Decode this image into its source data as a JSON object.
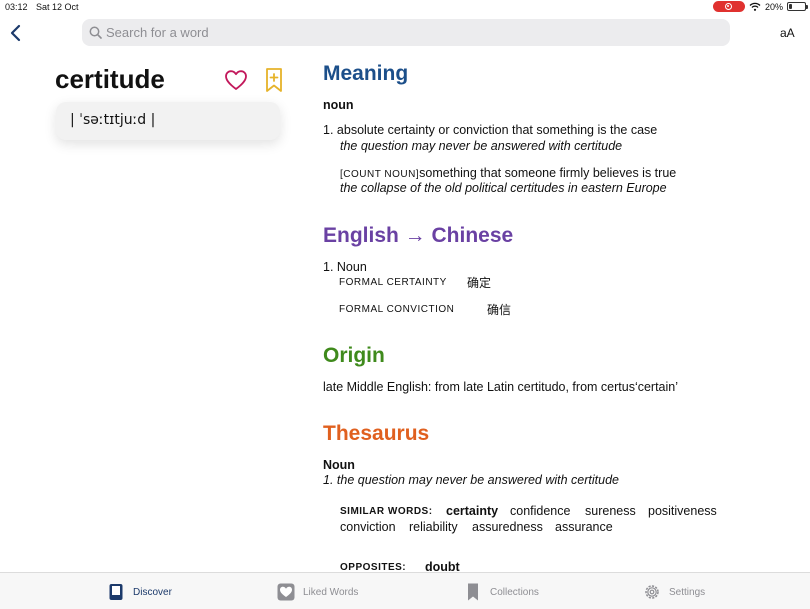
{
  "status_bar": {
    "time": "03:12",
    "date": "Sat 12 Oct",
    "battery": "20%",
    "battery_level": 0.2
  },
  "search": {
    "placeholder": "Search for a word",
    "value": ""
  },
  "text_size_button": "aA",
  "entry": {
    "word": "certitude",
    "pronunciation": "| ˈsəːtɪtjuːd |"
  },
  "meaning": {
    "heading": "Meaning",
    "pos": "noun",
    "senses": [
      {
        "number": "1.",
        "definition": "absolute certainty or conviction that something is the case",
        "example": "the question may never be answered with certitude"
      },
      {
        "label": "[COUNT NOUN]",
        "definition": "something that someone firmly believes is true",
        "example": "the collapse of the old political certitudes in eastern Europe"
      }
    ]
  },
  "translation": {
    "heading": "English → Chinese",
    "pos_line": "1. Noun",
    "items": [
      {
        "label": "FORMAL CERTAINTY",
        "value": "确定"
      },
      {
        "label": "FORMAL CONVICTION",
        "value": "确信"
      }
    ]
  },
  "origin": {
    "heading": "Origin",
    "text": "late Middle English: from late Latin certitudo, from certus‘certain’"
  },
  "thesaurus": {
    "heading": "Thesaurus",
    "pos": "Noun",
    "example": "1. the question may never be answered with certitude",
    "similar_label": "SIMILAR WORDS:",
    "similar_words": [
      "certainty",
      "confidence",
      "sureness",
      "positiveness",
      "conviction",
      "reliability",
      "assuredness",
      "assurance"
    ],
    "opposites_label": "OPPOSITES:",
    "opposites": [
      "doubt"
    ]
  },
  "tabs": [
    {
      "label": "Discover",
      "icon": "book-icon",
      "active": true
    },
    {
      "label": "Liked Words",
      "icon": "heart-icon",
      "active": false
    },
    {
      "label": "Collections",
      "icon": "bookmark-icon",
      "active": false
    },
    {
      "label": "Settings",
      "icon": "gear-icon",
      "active": false
    }
  ],
  "colors": {
    "meaning": "#1c4f8a",
    "translation": "#6a41a3",
    "origin": "#3f8a1c",
    "thesaurus": "#e0601f",
    "heart": "#c2185b",
    "bookmark": "#e6b32a",
    "recording": "#e0312f"
  }
}
